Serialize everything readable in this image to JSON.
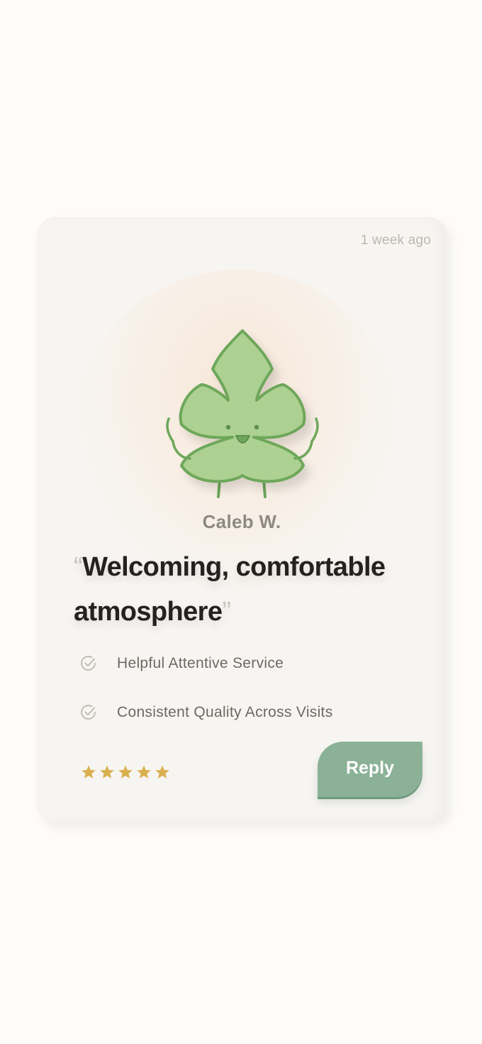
{
  "review": {
    "timestamp": "1 week ago",
    "reviewer_name": "Caleb W.",
    "quote_open": "“",
    "quote_text": "Welcoming, comfortable atmosphere",
    "quote_close": "”",
    "features": [
      {
        "icon": "check-circle-icon",
        "label": "Helpful Attentive Service"
      },
      {
        "icon": "check-circle-icon",
        "label": "Consistent Quality Across Visits"
      }
    ],
    "rating": 5,
    "reply_label": "Reply"
  },
  "colors": {
    "card_background": "#f7f5f2",
    "accent_green": "#8bb197",
    "star_gold": "#d9b04f",
    "leaf_fill": "#add192",
    "leaf_stroke": "#6ea75a"
  }
}
